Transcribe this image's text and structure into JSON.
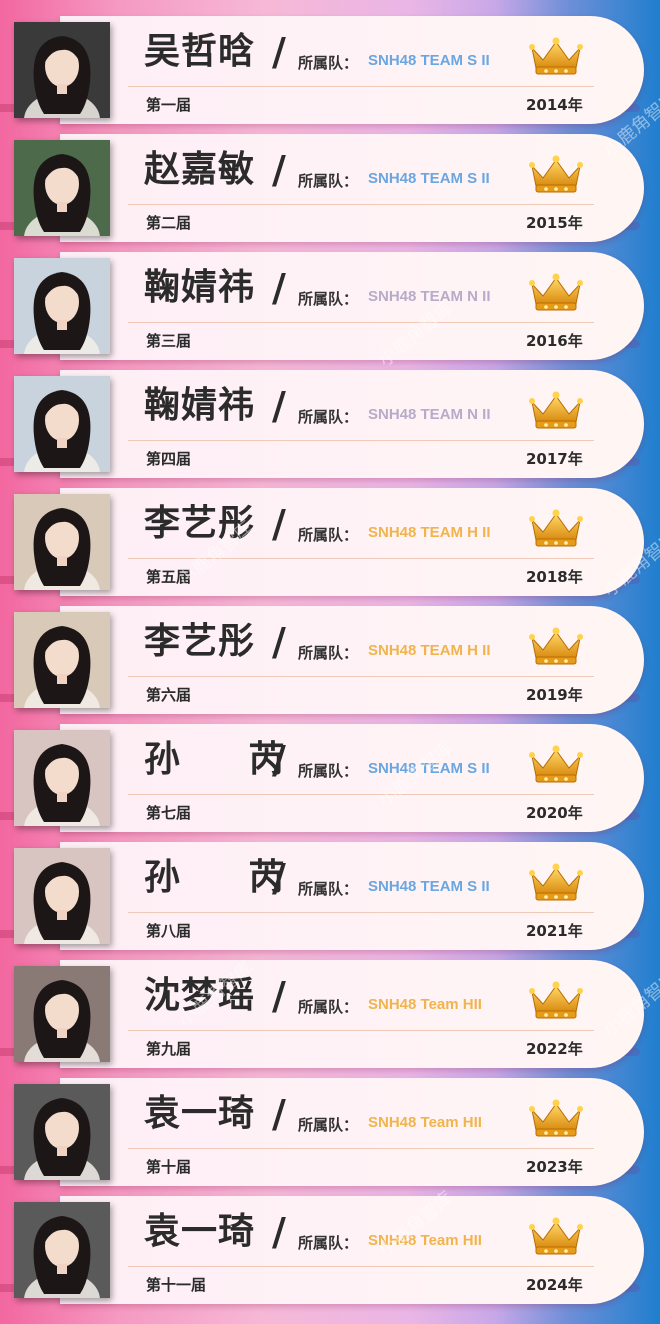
{
  "watermark_text": "小鹿角智库",
  "team_label": "所属队：",
  "slash": "/",
  "entries": [
    {
      "name": "吴哲晗",
      "team": "SNH48 TEAM S II",
      "team_color": "#6aa6e0",
      "edition": "第一届",
      "year": "2014年",
      "photo_tone": "#3a3a3a"
    },
    {
      "name": "赵嘉敏",
      "team": "SNH48 TEAM S II",
      "team_color": "#6aa6e0",
      "edition": "第二届",
      "year": "2015年",
      "photo_tone": "#4d6a4a"
    },
    {
      "name": "鞠婧祎",
      "team": "SNH48 TEAM N II",
      "team_color": "#b7abc9",
      "edition": "第三届",
      "year": "2016年",
      "photo_tone": "#c9d3de"
    },
    {
      "name": "鞠婧祎",
      "team": "SNH48 TEAM N II",
      "team_color": "#b7abc9",
      "edition": "第四届",
      "year": "2017年",
      "photo_tone": "#c9d3de"
    },
    {
      "name": "李艺彤",
      "team": "SNH48 TEAM H II",
      "team_color": "#f1b44c",
      "edition": "第五届",
      "year": "2018年",
      "photo_tone": "#d9c9b8"
    },
    {
      "name": "李艺彤",
      "team": "SNH48 TEAM H II",
      "team_color": "#f1b44c",
      "edition": "第六届",
      "year": "2019年",
      "photo_tone": "#d9c9b8"
    },
    {
      "name": "孙 芮",
      "team": "SNH48 TEAM S II",
      "team_color": "#6aa6e0",
      "edition": "第七届",
      "year": "2020年",
      "photo_tone": "#d8c4c0"
    },
    {
      "name": "孙 芮",
      "team": "SNH48 TEAM S II",
      "team_color": "#6aa6e0",
      "edition": "第八届",
      "year": "2021年",
      "photo_tone": "#d8c4c0"
    },
    {
      "name": "沈梦瑶",
      "team": "SNH48 Team HII",
      "team_color": "#f1b44c",
      "edition": "第九届",
      "year": "2022年",
      "photo_tone": "#8a7a76"
    },
    {
      "name": "袁一琦",
      "team": "SNH48 Team HII",
      "team_color": "#f1b44c",
      "edition": "第十届",
      "year": "2023年",
      "photo_tone": "#5a5a5a"
    },
    {
      "name": "袁一琦",
      "team": "SNH48 Team HII",
      "team_color": "#f1b44c",
      "edition": "第十一届",
      "year": "2024年",
      "photo_tone": "#5a5a5a"
    }
  ]
}
